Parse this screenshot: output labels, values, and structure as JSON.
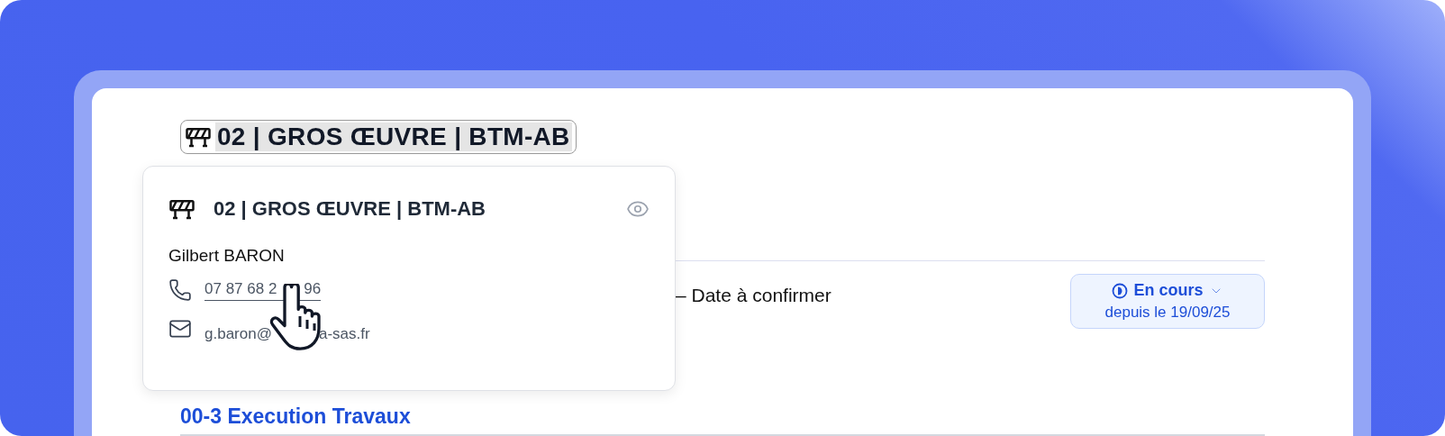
{
  "header": {
    "title": "02 | GROS ŒUVRE | BTM-AB"
  },
  "popover": {
    "title": "02 | GROS ŒUVRE | BTM-AB",
    "contact_name": "Gilbert BARON",
    "phone_parts": [
      "07 87 68 2",
      "96"
    ],
    "email_parts": [
      "g.baron@",
      "a-sas.fr"
    ]
  },
  "date_note": "– Date à confirmer",
  "status": {
    "label": "En cours",
    "since": "depuis le 19/09/25"
  },
  "section_link": "00-3 Execution Travaux"
}
